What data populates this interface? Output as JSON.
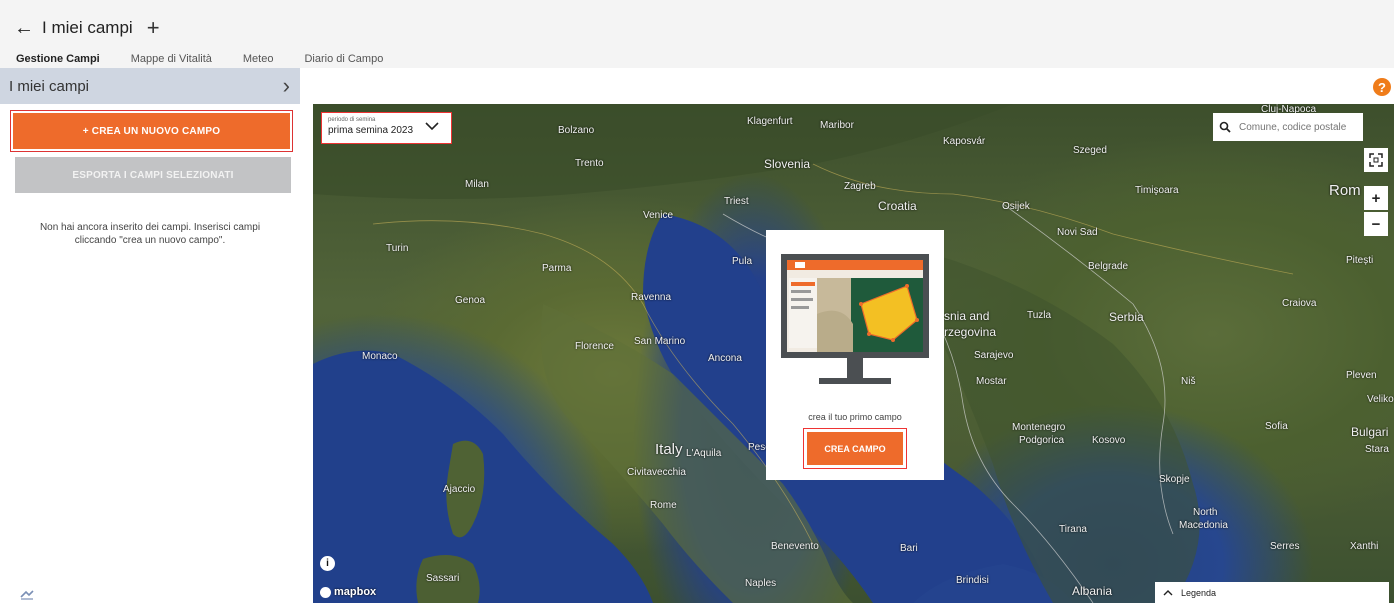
{
  "header": {
    "title": "I miei campi",
    "tabs": [
      {
        "label": "Gestione Campi",
        "active": true
      },
      {
        "label": "Mappe di Vitalità",
        "active": false
      },
      {
        "label": "Meteo",
        "active": false
      },
      {
        "label": "Diario di Campo",
        "active": false
      }
    ]
  },
  "sidebar": {
    "header_label": "I miei campi",
    "new_field_button": "+ CREA UN NUOVO CAMPO",
    "export_button": "ESPORTA I CAMPI SELEZIONATI",
    "empty_message": "Non hai ancora inserito dei campi. Inserisci campi cliccando \"crea un nuovo campo\"."
  },
  "help": {
    "label": "?"
  },
  "map": {
    "period": {
      "label": "periodo di semina",
      "value": "prima semina 2023"
    },
    "search": {
      "placeholder": "Comune, codice postale"
    },
    "controls": {
      "zoom_in": "+",
      "zoom_out": "−"
    },
    "labels": {
      "slovenia": "Slovenia",
      "croatia": "Croatia",
      "italy": "Italy",
      "serbia": "Serbia",
      "bosnia_1": "snia and",
      "bosnia_2": "rzegovina",
      "montenegro": "Montenegro",
      "kosovo": "Kosovo",
      "north": "North",
      "macedonia": "Macedonia",
      "albania": "Albania",
      "bulgaria": "Bulgari",
      "romania": "Rom",
      "monaco": "Monaco",
      "san_marino": "San Marino",
      "milan": "Milan",
      "venice": "Venice",
      "turin": "Turin",
      "genoa": "Genoa",
      "parma": "Parma",
      "ravenna": "Ravenna",
      "florence": "Florence",
      "ancona": "Ancona",
      "rome": "Rome",
      "naples": "Naples",
      "bari": "Bari",
      "belgrade": "Belgrade",
      "zagreb": "Zagreb",
      "sarajevo": "Sarajevo",
      "podgorica": "Podgorica",
      "skopje": "Skopje",
      "sofia": "Sofia",
      "tirana": "Tirana",
      "pula": "Pula",
      "trieste": "Triest",
      "bolzano": "Bolzano",
      "trento": "Trento",
      "klagenfurt": "Klagenfurt",
      "maribor": "Maribor",
      "kaposvar": "Kaposvár",
      "szeged": "Szeged",
      "osijek": "Osijek",
      "novi_sad": "Novi Sad",
      "timisoara": "Timişoara",
      "tuzla": "Tuzla",
      "mostar": "Mostar",
      "nis": "Niš",
      "craiova": "Craiova",
      "pitesti": "Pitești",
      "pleven": "Pleven",
      "veliko": "Veliko",
      "xanthi": "Xanthi",
      "serres": "Serres",
      "ajaccio": "Ajaccio",
      "sassari": "Sassari",
      "civitavecchia": "Civitavecchia",
      "laquila": "L'Aquila",
      "pescara": "Pesca",
      "benevento": "Benevento",
      "brindisi": "Brindisi",
      "cluj": "Cluj-Napoca",
      "stara": "Stara"
    },
    "attribution": "mapbox",
    "info_label": "i",
    "legend_label": "Legenda"
  },
  "modal": {
    "text": "crea il tuo primo campo",
    "button": "CREA CAMPO"
  },
  "colors": {
    "accent": "#ee6b2b",
    "sidebar_header": "#cfd6e1",
    "disabled_button": "#c2c3c5",
    "highlight_border": "#e33333",
    "help": "#ef7c1a"
  }
}
